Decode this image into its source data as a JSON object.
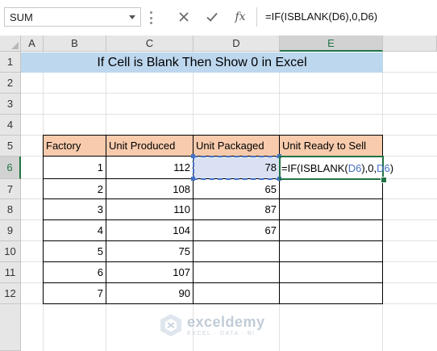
{
  "formula_bar": {
    "name_box": "SUM",
    "cancel_icon": "close-icon",
    "enter_icon": "check-icon",
    "fx_label": "fx",
    "formula": "=IF(ISBLANK(D6),0,D6)"
  },
  "columns": [
    "A",
    "B",
    "C",
    "D",
    "E"
  ],
  "active_column": "E",
  "rows": [
    "1",
    "2",
    "3",
    "4",
    "5",
    "6",
    "7",
    "8",
    "9",
    "10",
    "11",
    "12"
  ],
  "active_row": "6",
  "title": "If Cell is Blank Then Show 0 in Excel",
  "table": {
    "headers": [
      "Factory",
      "Unit Produced",
      "Unit Packaged",
      "Unit Ready to Sell"
    ],
    "rows": [
      {
        "factory": "1",
        "produced": "112",
        "packaged": "78",
        "ready": ""
      },
      {
        "factory": "2",
        "produced": "108",
        "packaged": "65",
        "ready": ""
      },
      {
        "factory": "3",
        "produced": "110",
        "packaged": "87",
        "ready": ""
      },
      {
        "factory": "4",
        "produced": "104",
        "packaged": "67",
        "ready": ""
      },
      {
        "factory": "5",
        "produced": "75",
        "packaged": "",
        "ready": ""
      },
      {
        "factory": "6",
        "produced": "107",
        "packaged": "",
        "ready": ""
      },
      {
        "factory": "7",
        "produced": "90",
        "packaged": "",
        "ready": ""
      }
    ]
  },
  "editing_cell": {
    "parts": [
      "=IF(ISBLANK(",
      "D6",
      "),0,",
      "D6",
      ")"
    ]
  },
  "watermark": {
    "name": "exceldemy",
    "tagline": "EXCEL · DATA · BI"
  },
  "colors": {
    "title_fill": "#bdd7ee",
    "header_fill": "#f8cbad",
    "selection_fill": "#d9e1f2",
    "reference_blue": "#4472c4",
    "excel_green": "#217346"
  }
}
